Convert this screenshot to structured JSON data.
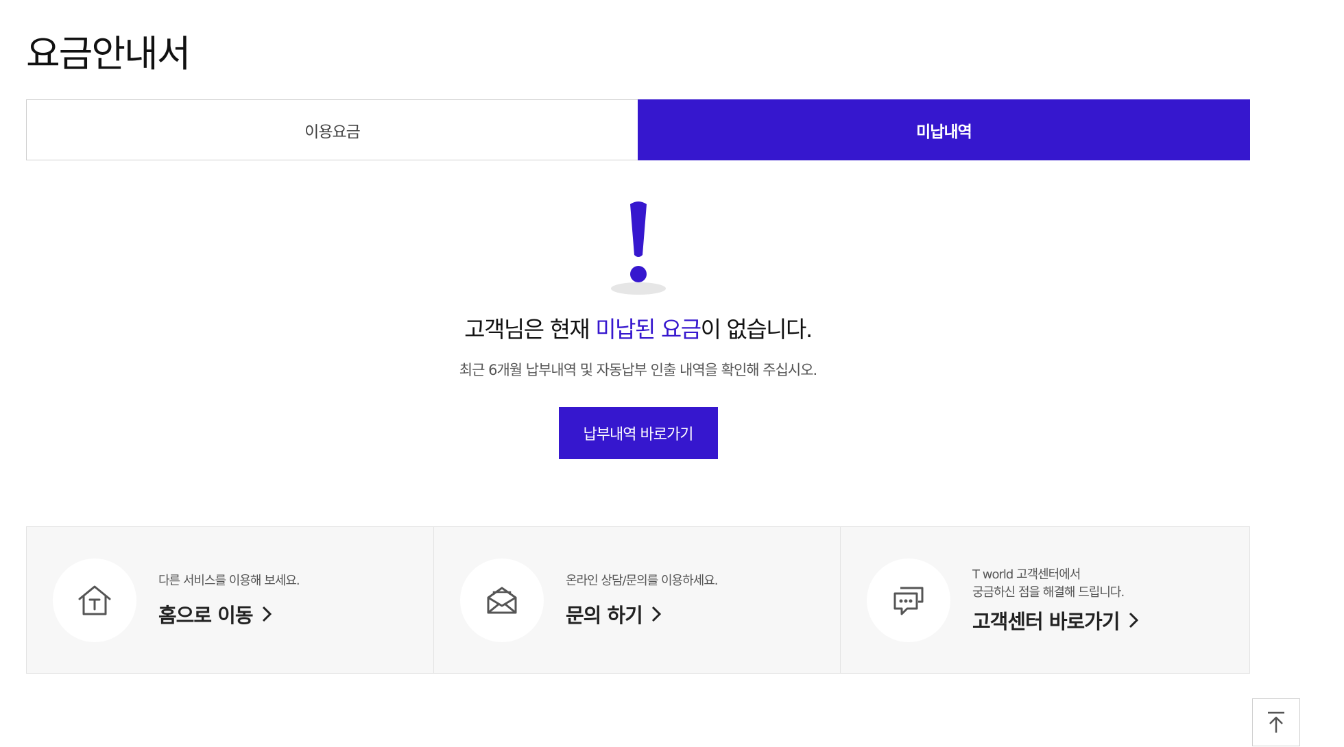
{
  "page": {
    "title": "요금안내서"
  },
  "tabs": [
    {
      "label": "이용요금",
      "active": false
    },
    {
      "label": "미납내역",
      "active": true
    }
  ],
  "notice": {
    "icon": "exclamation-icon",
    "headline_prefix": "고객님은 현재 ",
    "headline_accent": "미납된 요금",
    "headline_suffix": "이 없습니다.",
    "subtext": "최근 6개월 납부내역 및 자동납부 인출 내역을 확인해 주십시오.",
    "button_label": "납부내역 바로가기"
  },
  "quick_links": [
    {
      "icon": "home-t-icon",
      "description": [
        "다른 서비스를 이용해 보세요."
      ],
      "link_label": "홈으로 이동"
    },
    {
      "icon": "mail-icon",
      "description": [
        "온라인 상담/문의를 이용하세요."
      ],
      "link_label": "문의 하기"
    },
    {
      "icon": "chat-bubble-icon",
      "description": [
        "T world 고객센터에서",
        "궁금하신 점을 해결해 드립니다."
      ],
      "link_label": "고객센터 바로가기"
    }
  ],
  "scroll_top": {
    "icon": "arrow-up-to-top-icon"
  },
  "colors": {
    "accent": "#3617CE",
    "panel_bg": "#f7f7f7",
    "border": "#cfcfcf"
  }
}
